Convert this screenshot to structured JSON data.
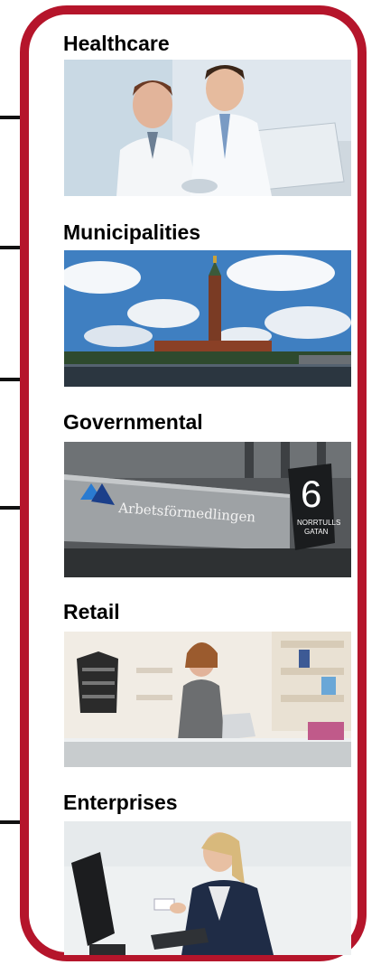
{
  "sections": [
    {
      "label": "Healthcare"
    },
    {
      "label": "Municipalities"
    },
    {
      "label": "Governmental"
    },
    {
      "label": "Retail"
    },
    {
      "label": "Enterprises"
    }
  ],
  "photos": {
    "governmental": {
      "sign_text": "Arbetsförmedlingen",
      "plate_number": "6",
      "plate_text_1": "NORRTULLS",
      "plate_text_2": "GATAN"
    }
  },
  "colors": {
    "frame": "#b5152b",
    "connector": "#111111"
  }
}
